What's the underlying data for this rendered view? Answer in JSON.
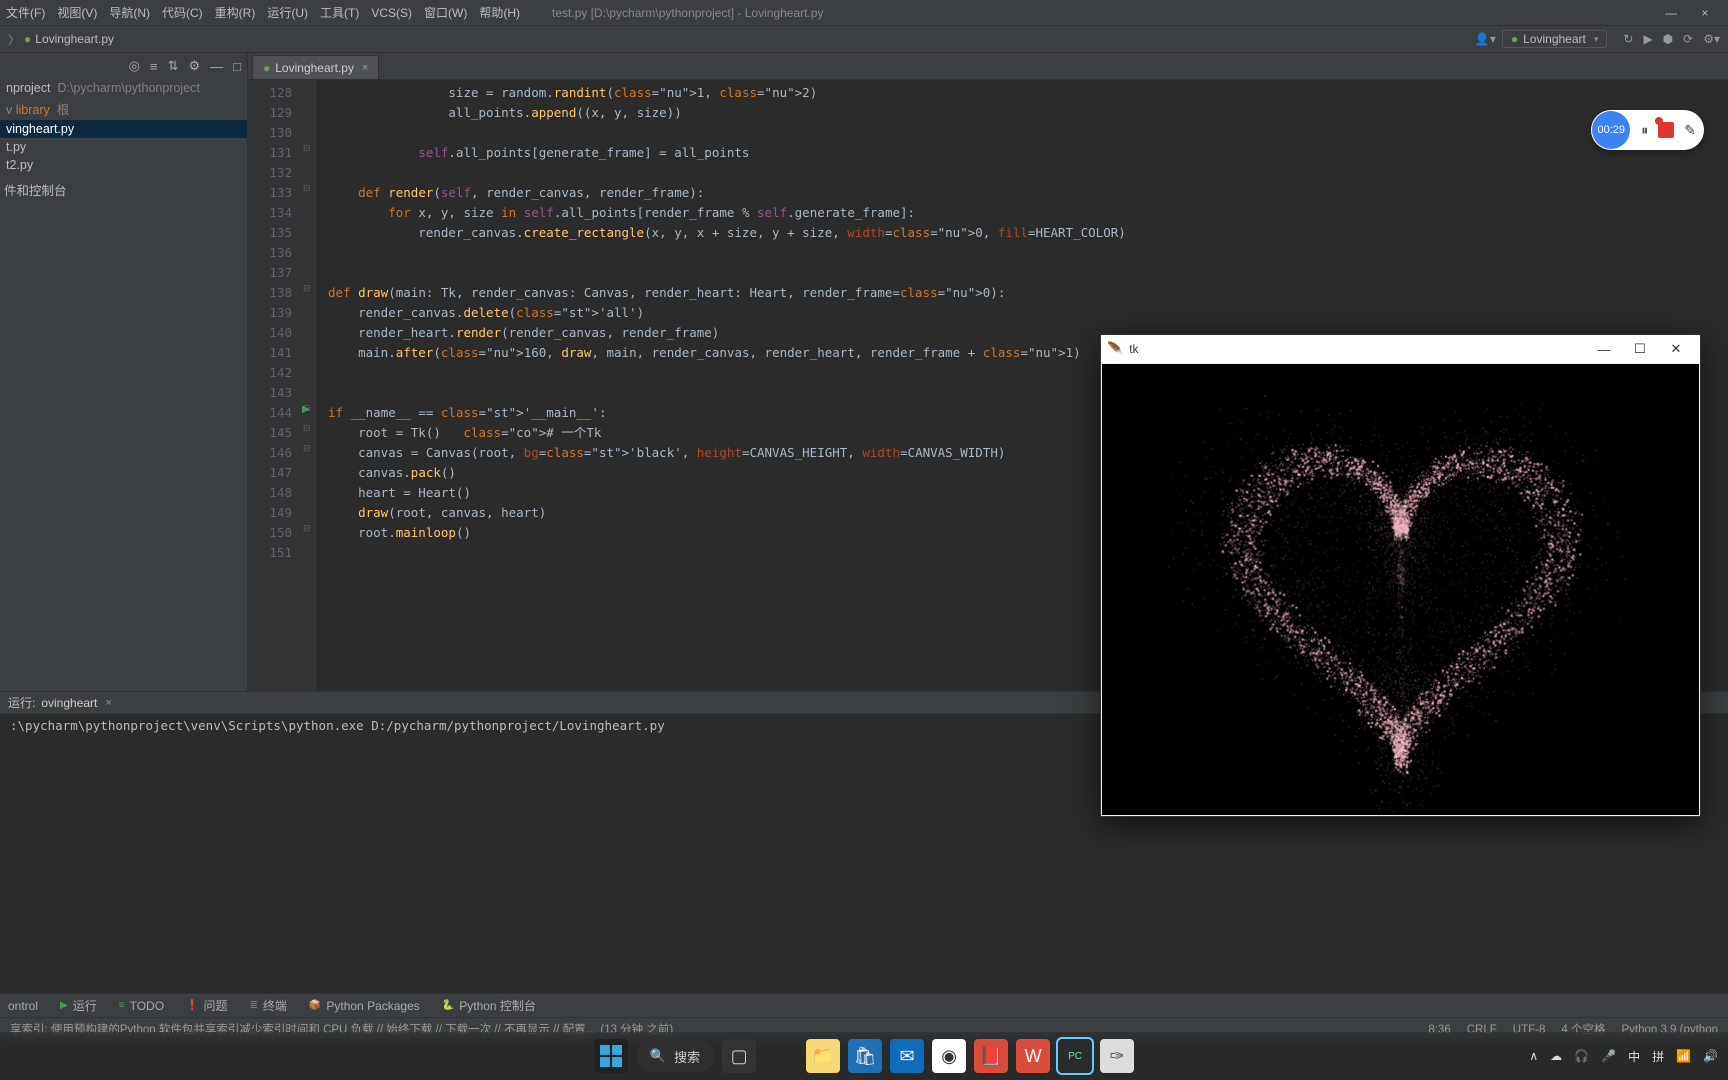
{
  "window": {
    "minimize": "—",
    "close": "×"
  },
  "menu": {
    "items": [
      "文件(F)",
      "视图(V)",
      "导航(N)",
      "代码(C)",
      "重构(R)",
      "运行(U)",
      "工具(T)",
      "VCS(S)",
      "窗口(W)",
      "帮助(H)"
    ],
    "title": "test.py [D:\\pycharm\\pythonproject] - Lovingheart.py"
  },
  "breadcrumb": {
    "icon": "●",
    "file": "Lovingheart.py"
  },
  "toolbar": {
    "user": "👤▾",
    "config_icon": "●",
    "config_name": "Lovingheart",
    "dd": "▾",
    "icons": [
      "↻",
      "▶",
      "⬢",
      "⟳",
      "⚙▾"
    ]
  },
  "sidebar": {
    "tool_icons": [
      "◎",
      "≡",
      "⇅",
      "⚙",
      "—",
      "□"
    ],
    "project": {
      "name": "nproject",
      "path": "D:\\pycharm\\pythonproject"
    },
    "lib": {
      "label": "library",
      "hint": "根"
    },
    "files": [
      "vingheart.py",
      "t.py",
      "t2.py"
    ],
    "ext": "件和控制台"
  },
  "tab": {
    "icon": "●",
    "name": "Lovingheart.py",
    "close": "×"
  },
  "code": {
    "first_line": 128,
    "lines": [
      "                size = random.randint(1, 2)",
      "                all_points.append((x, y, size))",
      "",
      "            self.all_points[generate_frame] = all_points",
      "",
      "    def render(self, render_canvas, render_frame):",
      "        for x, y, size in self.all_points[render_frame % self.generate_frame]:",
      "            render_canvas.create_rectangle(x, y, x + size, y + size, width=0, fill=HEART_COLOR)",
      "",
      "",
      "def draw(main: Tk, render_canvas: Canvas, render_heart: Heart, render_frame=0):",
      "    render_canvas.delete('all')",
      "    render_heart.render(render_canvas, render_frame)",
      "    main.after(160, draw, main, render_canvas, render_heart, render_frame + 1)",
      "",
      "",
      "if __name__ == '__main__':",
      "    root = Tk()   # 一个Tk",
      "    canvas = Canvas(root, bg='black', height=CANVAS_HEIGHT, width=CANVAS_WIDTH)",
      "    canvas.pack()",
      "    heart = Heart()",
      "    draw(root, canvas, heart)",
      "    root.mainloop()",
      ""
    ]
  },
  "run": {
    "label": "运行:",
    "name": "ovingheart",
    "close": "×",
    "output": ":\\pycharm\\pythonproject\\venv\\Scripts\\python.exe D:/pycharm/pythonproject/Lovingheart.py"
  },
  "bottom_tabs": [
    {
      "icon": "",
      "label": "ontrol"
    },
    {
      "icon": "▶",
      "label": "运行"
    },
    {
      "icon": "≡",
      "label": "TODO"
    },
    {
      "icon": "❗",
      "label": "问题"
    },
    {
      "icon": "≣",
      "label": "终端"
    },
    {
      "icon": "📦",
      "label": "Python Packages"
    },
    {
      "icon": "🐍",
      "label": "Python 控制台"
    }
  ],
  "status": {
    "msg": "享索引: 使用预构建的Python 软件包共享索引减少索引时间和 CPU 负载 // 始终下载 // 下载一次 // 不再显示 // 配置… (13 分钟 之前)",
    "cells": [
      "8:36",
      "CRLF",
      "UTF-8",
      "4 个空格",
      "Python 3.9 (python"
    ]
  },
  "tk": {
    "title": "tk",
    "min": "—",
    "max": "☐",
    "close": "✕"
  },
  "heart_color": "#f5b8c5",
  "recorder": {
    "time": "00:29",
    "pause": "⏸",
    "edit": "✎"
  },
  "taskbar": {
    "search_icon": "🔍",
    "search": "搜索",
    "apps": [
      {
        "name": "windows",
        "bg": "#0078d4",
        "txt": "⊞",
        "c": "#fff"
      },
      {
        "name": "taskview",
        "bg": "#333",
        "txt": "▢",
        "c": "#ccc"
      },
      {
        "name": "edge",
        "bg": "linear",
        "txt": "",
        "svg": true
      },
      {
        "name": "explorer",
        "bg": "#f8d775",
        "txt": "📁",
        "c": "#333"
      },
      {
        "name": "store",
        "bg": "#1f6fb2",
        "txt": "🛍",
        "c": "#fff"
      },
      {
        "name": "mail",
        "bg": "#0f6cbd",
        "txt": "✉",
        "c": "#fff"
      },
      {
        "name": "chrome",
        "bg": "#fff",
        "txt": "◉",
        "c": "#333"
      },
      {
        "name": "red1",
        "bg": "#d94b3a",
        "txt": "📕",
        "c": "#fff"
      },
      {
        "name": "wps",
        "bg": "#d94b3a",
        "txt": "W",
        "c": "#fff"
      },
      {
        "name": "pycharm",
        "bg": "#2b2b2b",
        "txt": "PC",
        "c": "#6e9",
        "fs": "10px",
        "b": "1"
      },
      {
        "name": "feather",
        "bg": "#ddd",
        "txt": "✑",
        "c": "#555"
      }
    ],
    "tray": [
      "∧",
      "☁",
      "🎧",
      "🎤",
      "中",
      "拼",
      "📶",
      "🔊"
    ]
  }
}
